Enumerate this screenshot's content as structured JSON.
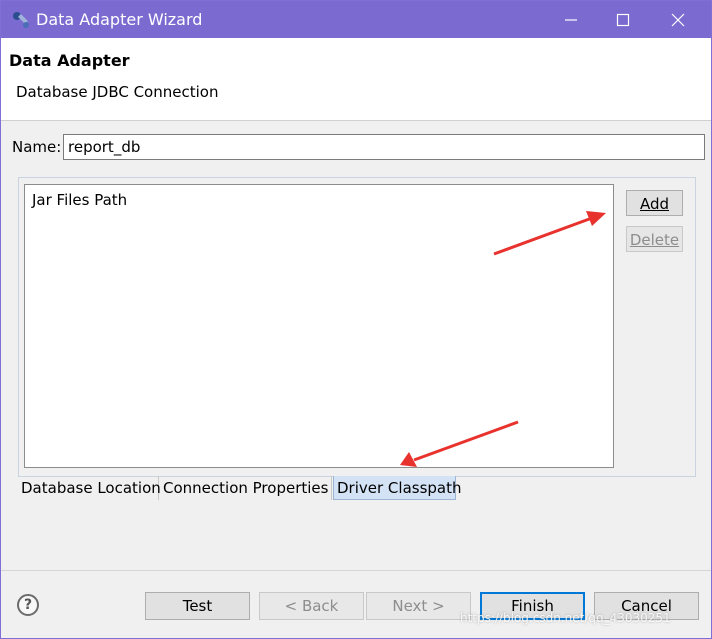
{
  "window": {
    "title": "Data Adapter Wizard",
    "accent_color": "#7b6ad0"
  },
  "header": {
    "title": "Data Adapter",
    "description": "Database JDBC Connection"
  },
  "name_field": {
    "label": "Name:",
    "value": "report_db"
  },
  "driver_classpath": {
    "list_header": "Jar Files Path",
    "add_label": "Add",
    "delete_label": "Delete"
  },
  "tabs": [
    {
      "label": "Database Location",
      "selected": false
    },
    {
      "label": "Connection Properties",
      "selected": false
    },
    {
      "label": "Driver Classpath",
      "selected": true
    }
  ],
  "footer": {
    "help_symbol": "?",
    "test_label": "Test",
    "back_label": "< Back",
    "next_label": "Next >",
    "finish_label": "Finish",
    "cancel_label": "Cancel"
  },
  "annotation_arrow_color": "#e8322d",
  "watermark": "https://blog.csdn.net/qq_43030251"
}
